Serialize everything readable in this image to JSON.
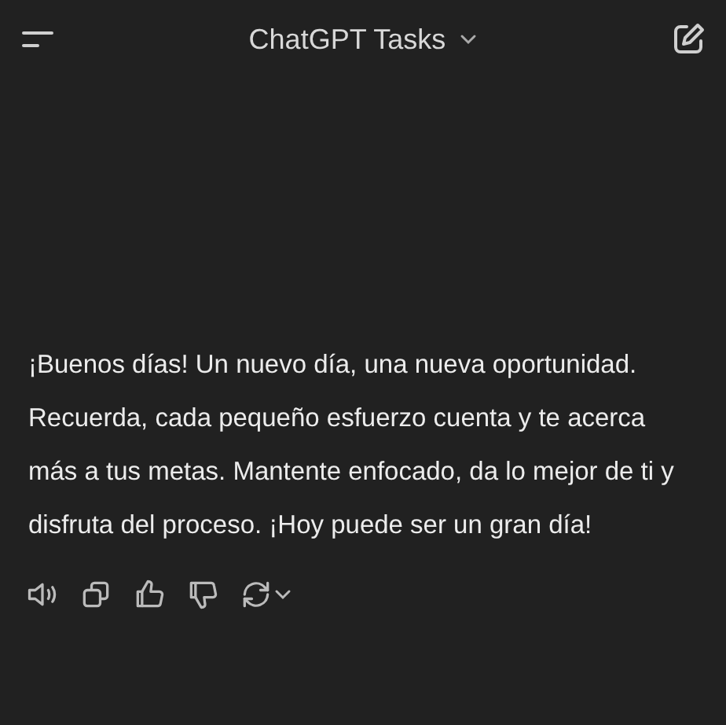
{
  "header": {
    "title": "ChatGPT Tasks"
  },
  "message": {
    "text": "¡Buenos días! Un nuevo día, una nueva oportunidad. Recuerda, cada pequeño esfuerzo cuenta y te acerca más a tus metas. Mantente enfocado, da lo mejor de ti y disfruta del proceso. ¡Hoy puede ser un gran día!"
  }
}
